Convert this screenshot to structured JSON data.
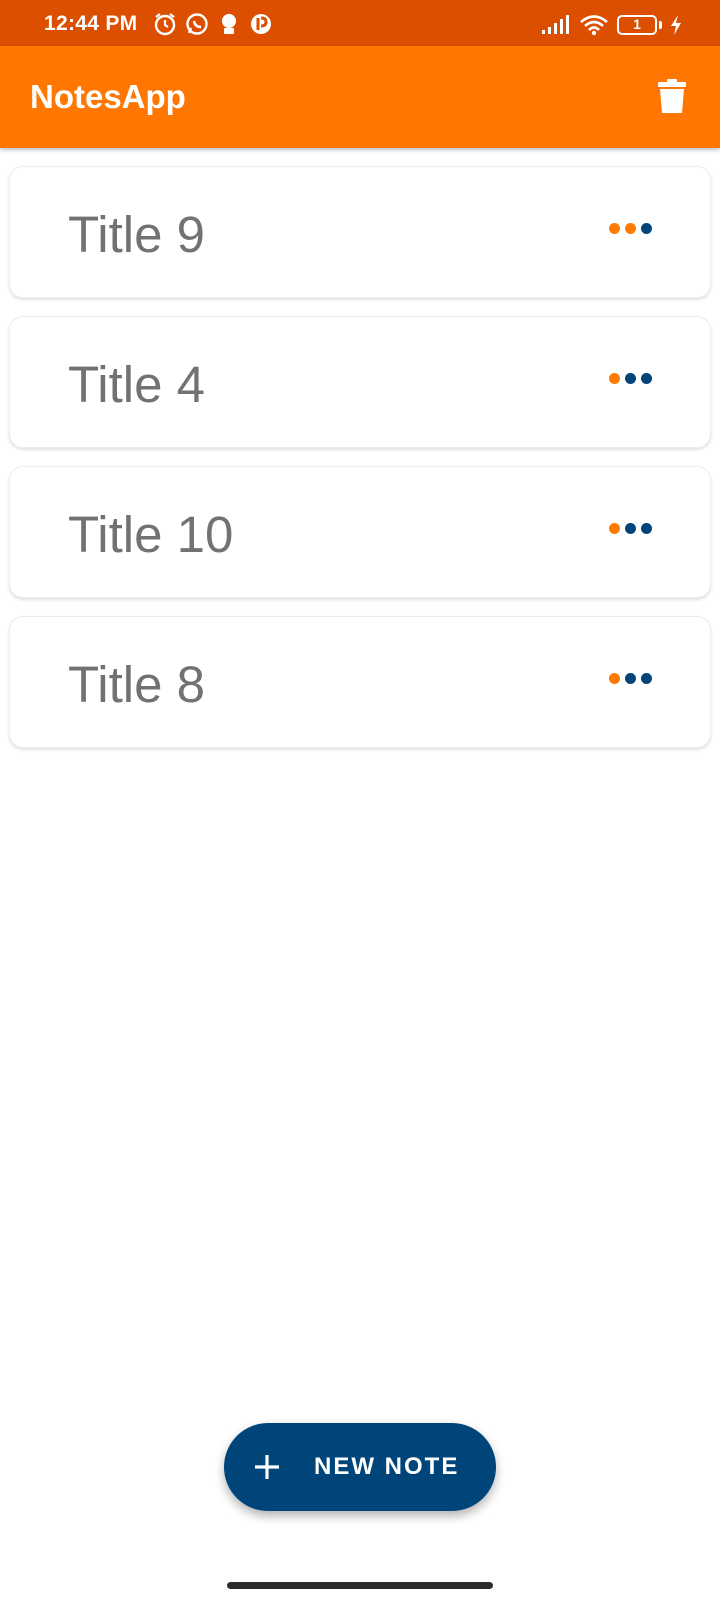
{
  "status_bar": {
    "time": "12:44 PM",
    "battery_level": "1",
    "icons": [
      "alarm-icon",
      "whatsapp-icon",
      "notification-icon",
      "app-icon",
      "signal-icon",
      "wifi-icon",
      "battery-icon",
      "charging-icon"
    ]
  },
  "app_bar": {
    "title": "NotesApp",
    "action_icon": "trash-icon"
  },
  "notes": [
    {
      "title": "Title 9"
    },
    {
      "title": "Title 4"
    },
    {
      "title": "Title 10"
    },
    {
      "title": "Title 8"
    }
  ],
  "fab": {
    "label": "NEW NOTE",
    "icon": "plus-icon"
  },
  "colors": {
    "status_bar": "#dc4e00",
    "app_bar": "#ff7700",
    "accent_blue": "#00457a",
    "accent_orange": "#ff7a00",
    "note_title": "#727272"
  }
}
